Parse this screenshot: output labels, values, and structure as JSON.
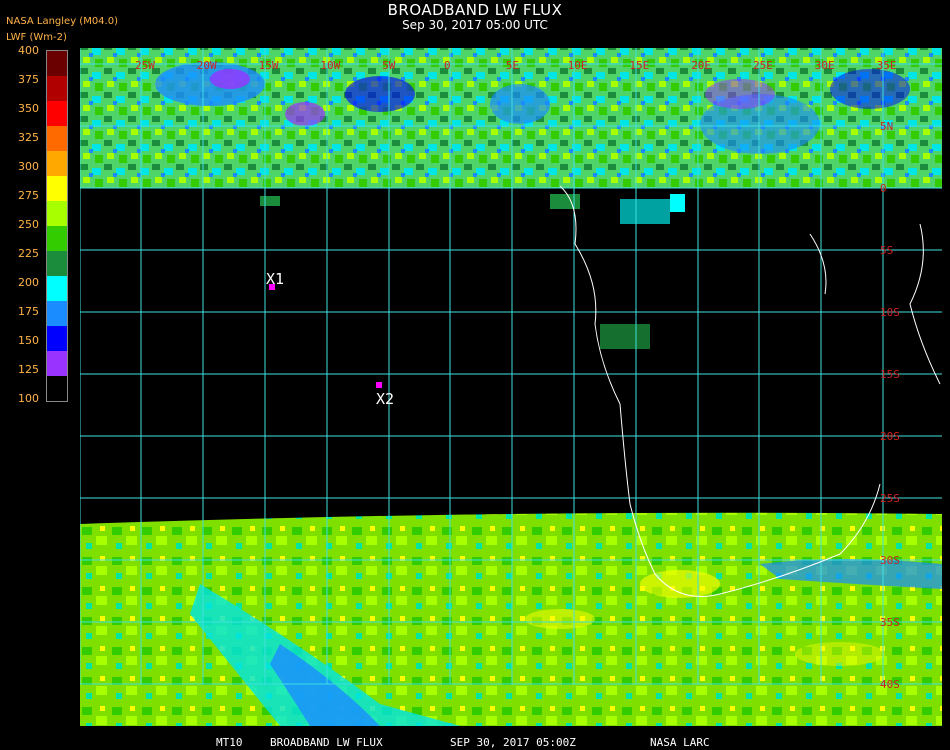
{
  "header": {
    "title": "BROADBAND LW FLUX",
    "datetime": "Sep 30, 2017 05:00 UTC",
    "org": "NASA Langley (M04.0)",
    "unit": "LWF (Wm-2)"
  },
  "colorbar": {
    "ticks": [
      "400",
      "375",
      "350",
      "325",
      "300",
      "275",
      "250",
      "225",
      "200",
      "175",
      "150",
      "125",
      "100"
    ],
    "colors": [
      "#6b0000",
      "#b00000",
      "#ff0000",
      "#ff6a00",
      "#ffa800",
      "#ffff00",
      "#a8ff00",
      "#33cc00",
      "#1a8c3c",
      "#00ffff",
      "#1a8cff",
      "#0000ff",
      "#9933ff"
    ]
  },
  "map": {
    "lon_labels": [
      "25W",
      "20W",
      "15W",
      "10W",
      "5W",
      "0",
      "5E",
      "10E",
      "15E",
      "20E",
      "25E",
      "30E",
      "35E"
    ],
    "lat_labels": [
      "5N",
      "0",
      "5S",
      "10S",
      "15S",
      "20S",
      "25S",
      "30S",
      "35S",
      "40S"
    ],
    "markers": [
      {
        "label": "X1"
      },
      {
        "label": "X2"
      }
    ]
  },
  "footer": {
    "product": "MT10",
    "name": "BROADBAND LW FLUX",
    "stamp": "SEP 30, 2017 05:00Z",
    "agency": "NASA LARC"
  }
}
